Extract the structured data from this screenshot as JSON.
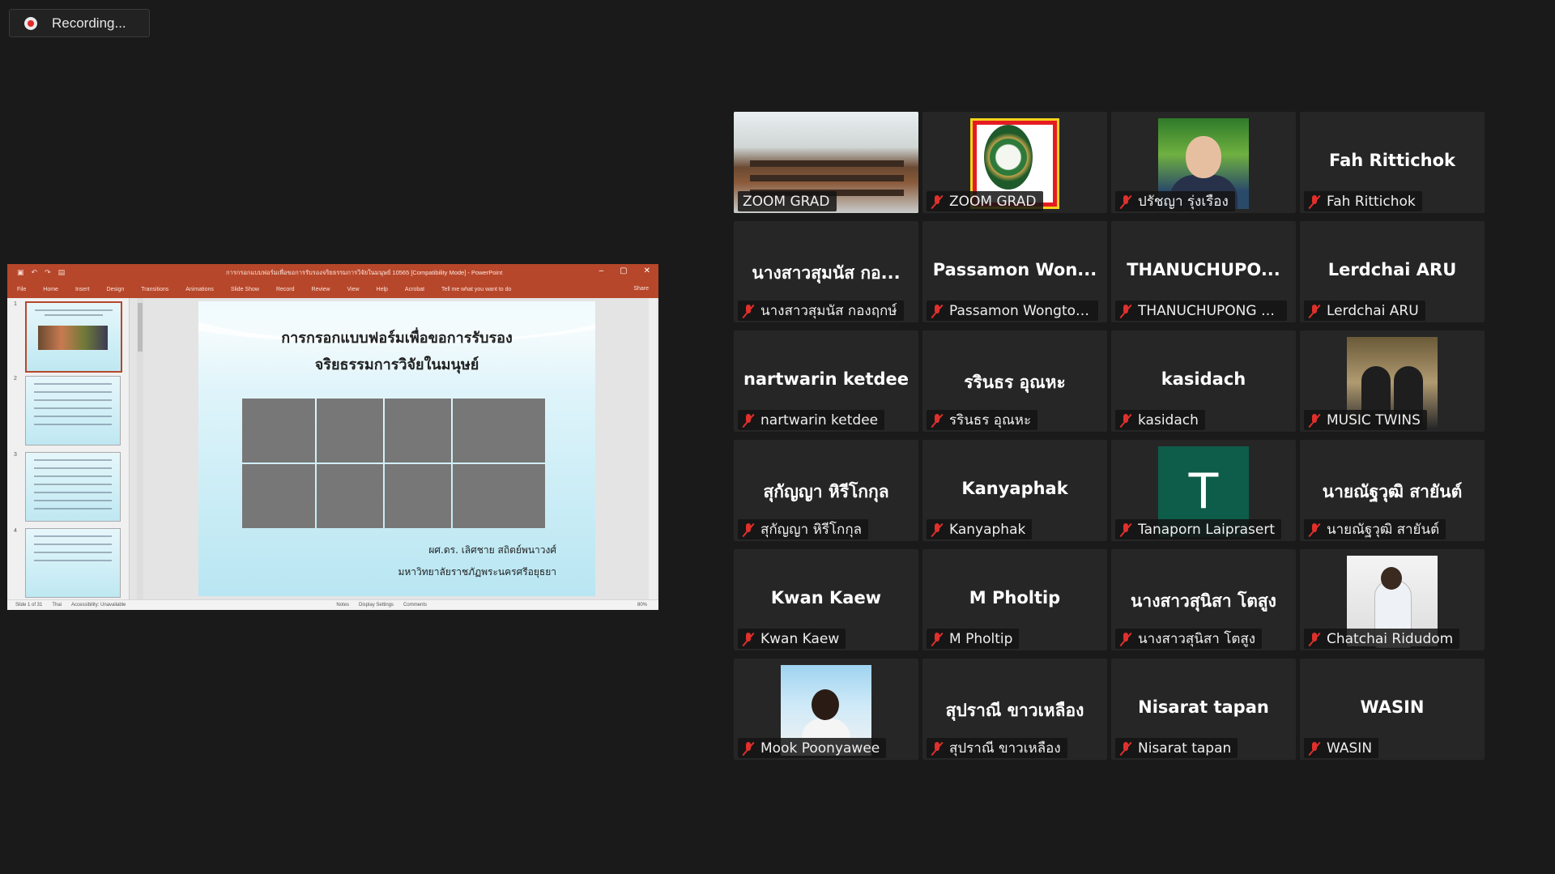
{
  "recording": {
    "label": "Recording..."
  },
  "powerpoint": {
    "doc_title": "การกรอกแบบฟอร์มเพื่อขอการรับรองจริยธรรมการวิจัยในมนุษย์ 10565 [Compatibility Mode] - PowerPoint",
    "ribbon_tabs": [
      "File",
      "Home",
      "Insert",
      "Design",
      "Transitions",
      "Animations",
      "Slide Show",
      "Record",
      "Review",
      "View",
      "Help",
      "Acrobat",
      "Tell me what you want to do"
    ],
    "share_label": "Share",
    "thumb_numbers": [
      "1",
      "2",
      "3",
      "4"
    ],
    "slide": {
      "title_line1": "การกรอกแบบฟอร์มเพื่อขอการรับรอง",
      "title_line2": "จริยธรรมการวิจัยในมนุษย์",
      "author": "ผศ.ดร. เลิศชาย สถิตย์พนาวงศ์",
      "university": "มหาวิทยาลัยราชภัฏพระนครศรีอยุธยา"
    },
    "status": {
      "slide_count": "Slide 1 of 31",
      "language": "Thai",
      "accessibility": "Accessibility: Unavailable",
      "notes": "Notes",
      "display": "Display Settings",
      "comments": "Comments",
      "zoom": "80%"
    }
  },
  "gallery": [
    {
      "row": 0,
      "col": 0,
      "big": "",
      "name": "ZOOM GRAD",
      "photo": "room",
      "active": true,
      "muted": false
    },
    {
      "row": 0,
      "col": 1,
      "big": "",
      "name": "ZOOM GRAD",
      "photo": "logo",
      "active": false,
      "muted": true
    },
    {
      "row": 0,
      "col": 2,
      "big": "",
      "name": "ปรัชญา รุ่งเรือง",
      "photo": "man",
      "active": false,
      "muted": true
    },
    {
      "row": 0,
      "col": 3,
      "big": "Fah Rittichok",
      "name": "Fah Rittichok",
      "photo": "",
      "active": false,
      "muted": true
    },
    {
      "row": 1,
      "col": 0,
      "big": "นางสาวสุมนัส กอ...",
      "name": "นางสาวสุมนัส กองฤกษ์",
      "photo": "",
      "active": false,
      "muted": true
    },
    {
      "row": 1,
      "col": 1,
      "big": "Passamon Won...",
      "name": "Passamon Wongtong...",
      "photo": "",
      "active": false,
      "muted": true
    },
    {
      "row": 1,
      "col": 2,
      "big": "THANUCHUPO...",
      "name": "THANUCHUPONG VI...",
      "photo": "",
      "active": false,
      "muted": true
    },
    {
      "row": 1,
      "col": 3,
      "big": "Lerdchai ARU",
      "name": "Lerdchai ARU",
      "photo": "",
      "active": false,
      "muted": true
    },
    {
      "row": 2,
      "col": 0,
      "big": "nartwarin ketdee",
      "name": "nartwarin ketdee",
      "photo": "",
      "active": false,
      "muted": true
    },
    {
      "row": 2,
      "col": 1,
      "big": "รรินธร อุณหะ",
      "name": "รรินธร อุณหะ",
      "photo": "",
      "active": false,
      "muted": true
    },
    {
      "row": 2,
      "col": 2,
      "big": "kasidach",
      "name": "kasidach",
      "photo": "",
      "active": false,
      "muted": true
    },
    {
      "row": 2,
      "col": 3,
      "big": "",
      "name": "MUSIC TWINS",
      "photo": "twins",
      "active": false,
      "muted": true
    },
    {
      "row": 3,
      "col": 0,
      "big": "สุกัญญา หิรีโกกุล",
      "name": "สุกัญญา หิรีโกกุล",
      "photo": "",
      "active": false,
      "muted": true
    },
    {
      "row": 3,
      "col": 1,
      "big": "Kanyaphak",
      "name": "Kanyaphak",
      "photo": "",
      "active": false,
      "muted": true
    },
    {
      "row": 3,
      "col": 2,
      "big": "",
      "name": "Tanaporn Laiprasert",
      "photo": "avatar",
      "avatar_letter": "T",
      "active": false,
      "muted": true
    },
    {
      "row": 3,
      "col": 3,
      "big": "นายณัฐวุฒิ สายันต์",
      "name": "นายณัฐวุฒิ สายันต์",
      "photo": "",
      "active": false,
      "muted": true
    },
    {
      "row": 4,
      "col": 0,
      "big": "Kwan Kaew",
      "name": "Kwan Kaew",
      "photo": "",
      "active": false,
      "muted": true
    },
    {
      "row": 4,
      "col": 1,
      "big": "M Pholtip",
      "name": "M Pholtip",
      "photo": "",
      "active": false,
      "muted": true
    },
    {
      "row": 4,
      "col": 2,
      "big": "นางสาวสุนิสา โตสูง",
      "name": "นางสาวสุนิสา โตสูง",
      "photo": "",
      "active": false,
      "muted": true
    },
    {
      "row": 4,
      "col": 3,
      "big": "",
      "name": "Chatchai Ridudom",
      "photo": "chat",
      "active": false,
      "muted": true
    },
    {
      "row": 5,
      "col": 0,
      "big": "",
      "name": "Mook Poonyawee",
      "photo": "mook",
      "active": false,
      "muted": true
    },
    {
      "row": 5,
      "col": 1,
      "big": "สุปราณี ขาวเหลือง",
      "name": "สุปราณี ขาวเหลือง",
      "photo": "",
      "active": false,
      "muted": true
    },
    {
      "row": 5,
      "col": 2,
      "big": "Nisarat tapan",
      "name": "Nisarat tapan",
      "photo": "",
      "active": false,
      "muted": true
    },
    {
      "row": 5,
      "col": 3,
      "big": "WASIN",
      "name": "WASIN",
      "photo": "",
      "active": false,
      "muted": true
    }
  ]
}
